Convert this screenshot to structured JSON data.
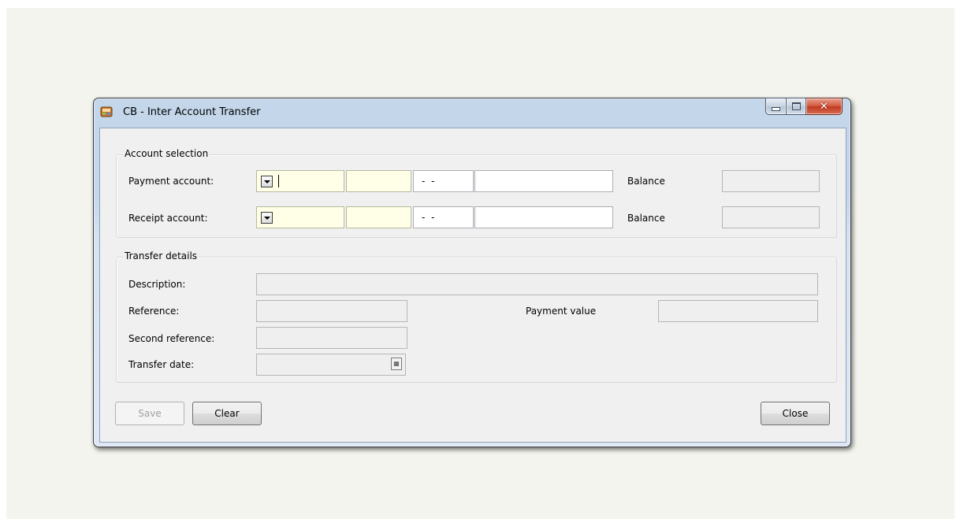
{
  "window": {
    "title": "CB - Inter Account Transfer"
  },
  "account_selection": {
    "legend": "Account selection",
    "payment_label": "Payment account:",
    "receipt_label": "Receipt account:",
    "payment_date_field": "- -",
    "receipt_date_field": "- -",
    "balance_label": "Balance"
  },
  "transfer_details": {
    "legend": "Transfer details",
    "description_label": "Description:",
    "reference_label": "Reference:",
    "second_reference_label": "Second reference:",
    "transfer_date_label": "Transfer date:",
    "payment_value_label": "Payment value"
  },
  "buttons": {
    "save": "Save",
    "clear": "Clear",
    "close": "Close"
  }
}
